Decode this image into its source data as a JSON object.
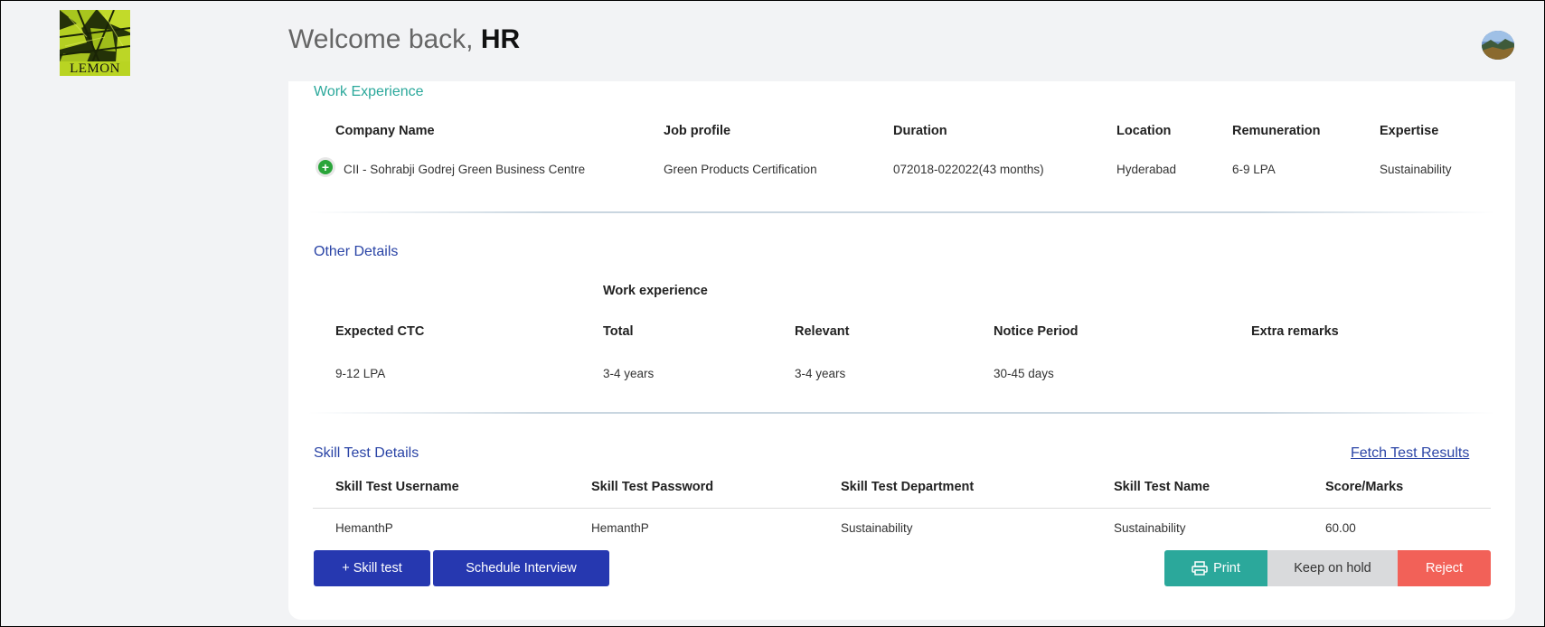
{
  "header": {
    "logo_text": "LEMON",
    "welcome_prefix": "Welcome back,",
    "user_name": "HR"
  },
  "work_experience": {
    "title": "Work Experience",
    "columns": [
      "Company Name",
      "Job profile",
      "Duration",
      "Location",
      "Remuneration",
      "Expertise"
    ],
    "rows": [
      [
        "CII - Sohrabji Godrej Green Business Centre",
        "Green Products Certification",
        "072018-022022(43 months)",
        "Hyderabad",
        "6-9 LPA",
        "Sustainability"
      ]
    ]
  },
  "other_details": {
    "title": "Other Details",
    "group_label": "Work experience",
    "columns": [
      "Expected CTC",
      "Total",
      "Relevant",
      "Notice Period",
      "Extra remarks"
    ],
    "values": [
      "9-12 LPA",
      "3-4 years",
      "3-4 years",
      "30-45 days",
      ""
    ]
  },
  "skill_test": {
    "title": "Skill Test Details",
    "fetch_link": "Fetch Test Results",
    "columns": [
      "Skill Test Username",
      "Skill Test Password",
      "Skill Test Department",
      "Skill Test Name",
      "Score/Marks"
    ],
    "rows": [
      [
        "HemanthP",
        "HemanthP",
        "Sustainability",
        "Sustainability",
        "60.00"
      ]
    ]
  },
  "actions": {
    "skill_test": "+ Skill test",
    "schedule_interview": "Schedule Interview",
    "print": "Print",
    "keep_on_hold": "Keep on hold",
    "reject": "Reject"
  },
  "colors": {
    "primary_blue": "#2638b0",
    "teal": "#2ba89b",
    "red": "#f26158",
    "grey": "#d9dadc"
  },
  "icons": [
    "plus-circle-icon",
    "printer-icon",
    "user-avatar"
  ]
}
